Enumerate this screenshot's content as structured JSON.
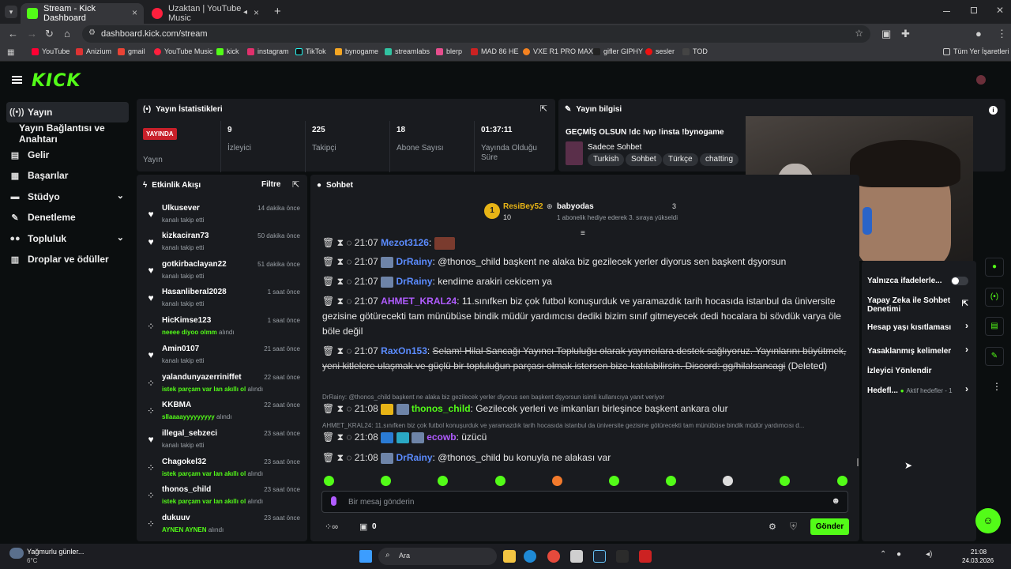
{
  "browser": {
    "tabs": [
      {
        "label": "Stream - Kick Dashboard",
        "close": "×"
      },
      {
        "label": "Uzaktan | YouTube Music",
        "close": "×"
      }
    ],
    "new_tab": "+",
    "url": "dashboard.kick.com/stream",
    "bookmarks": [
      "YouTube",
      "Anizium",
      "gmail",
      "YouTube Music",
      "kick",
      "instagram",
      "TikTok",
      "bynogame",
      "streamlabs",
      "blerp",
      "MAD 86 HE",
      "VXE R1 PRO MAX",
      "gifler GIPHY",
      "sesler",
      "TOD"
    ],
    "all_bookmarks": "Tüm Yer İşaretleri"
  },
  "brand": {
    "logo": "KICK",
    "accent": "#53fc18"
  },
  "sidebar": {
    "items": [
      {
        "label": "Yayın"
      },
      {
        "label": "Yayın Bağlantısı ve Anahtarı"
      },
      {
        "label": "Gelir"
      },
      {
        "label": "Başarılar"
      },
      {
        "label": "Stüdyo"
      },
      {
        "label": "Denetleme"
      },
      {
        "label": "Topluluk"
      },
      {
        "label": "Droplar ve ödüller"
      }
    ]
  },
  "stats": {
    "title": "Yayın İstatistikleri",
    "live_badge": "YAYINDA",
    "live_label": "Yayın",
    "cells": [
      {
        "value": "9",
        "label": "İzleyici"
      },
      {
        "value": "225",
        "label": "Takipçi"
      },
      {
        "value": "18",
        "label": "Abone Sayısı"
      },
      {
        "value": "01:37:11",
        "label": "Yayında Olduğu Süre"
      }
    ]
  },
  "info": {
    "title": "Yayın bilgisi",
    "stream_title": "GEÇMİŞ OLSUN !dc !wp !insta !bynogame",
    "category": "Sadece Sohbet",
    "tags": [
      "Turkish",
      "Sohbet",
      "Türkçe",
      "chatting"
    ]
  },
  "activity": {
    "title": "Etkinlik Akışı",
    "filter": "Filtre",
    "items": [
      {
        "name": "Ulkusever",
        "time": "14 dakika önce",
        "sub": "kanalı takip etti",
        "redeem": ""
      },
      {
        "name": "kizkaciran73",
        "time": "50 dakika önce",
        "sub": "kanalı takip etti",
        "redeem": ""
      },
      {
        "name": "gotkirbaclayan22",
        "time": "51 dakika önce",
        "sub": "kanalı takip etti",
        "redeem": ""
      },
      {
        "name": "Hasanliberal2028",
        "time": "1 saat önce",
        "sub": "kanalı takip etti",
        "redeem": ""
      },
      {
        "name": "HicKimse123",
        "time": "1 saat önce",
        "sub": "alındı",
        "redeem": "neeee diyoo olmm"
      },
      {
        "name": "Amin0107",
        "time": "21 saat önce",
        "sub": "kanalı takip etti",
        "redeem": ""
      },
      {
        "name": "yalandunyazerriniffet",
        "time": "22 saat önce",
        "sub": "alındı",
        "redeem": "istek parçam var lan akıllı ol"
      },
      {
        "name": "KKBMA",
        "time": "22 saat önce",
        "sub": "alındı",
        "redeem": "sllaaaayyyyyyyyy"
      },
      {
        "name": "illegal_sebzeci",
        "time": "23 saat önce",
        "sub": "kanalı takip etti",
        "redeem": ""
      },
      {
        "name": "Chagokel32",
        "time": "23 saat önce",
        "sub": "alındı",
        "redeem": "istek parçam var lan akıllı ol"
      },
      {
        "name": "thonos_child",
        "time": "23 saat önce",
        "sub": "alındı",
        "redeem": "istek parçam var lan akıllı ol"
      },
      {
        "name": "dukuuv",
        "time": "23 saat önce",
        "sub": "alındı",
        "redeem": "AYNEN AYNEN"
      }
    ]
  },
  "chat": {
    "title": "Sohbet",
    "pinned": {
      "rank": "1",
      "user": "ResiBey52",
      "count": "10",
      "gifter": "babyodas",
      "gift_count": "3",
      "note": "1 abonelik hediye ederek 3. sıraya yükseldi"
    },
    "messages": [
      {
        "time": "21:07",
        "user": "Mezot3126",
        "color": "#5b8cff",
        "text": "",
        "deleted": false
      },
      {
        "time": "21:07",
        "user": "DrRainy",
        "color": "#5b8cff",
        "text": "@thonos_child başkent ne alaka biz gezilecek yerler diyorus sen başkent dşyorsun",
        "deleted": false
      },
      {
        "time": "21:07",
        "user": "DrRainy",
        "color": "#5b8cff",
        "text": "kendime arakiri cekicem ya",
        "deleted": false
      },
      {
        "time": "21:07",
        "user": "AHMET_KRAL24",
        "color": "#b05cff",
        "text": "11.sınıfken biz çok futbol konuşurduk ve yaramazdık tarih hocasıda istanbul da üniversite gezisine götürecekti tam münübüse bindik müdür yardımcısı dediki bizim sınıf gitmeyecek dedi hocalara bi sövdük varya öle böle değil",
        "deleted": false
      },
      {
        "time": "21:07",
        "user": "RaxOn153",
        "color": "#5b8cff",
        "text": "Selam! Hilal Sancağı Yayıncı Topluluğu olarak yayıncılara destek sağlıyoruz. Yayınlarını büyütmek, yeni kitlelere ulaşmak ve güçlü bir topluluğun parçası olmak istersen bize katılabilirsin. Discord: gg/hilalsancagi",
        "deleted": true,
        "deleted_label": "(Deleted)"
      },
      {
        "time": "21:08",
        "user": "thonos_child",
        "color": "#53fc18",
        "text": "Gezilecek yerleri ve imkanları birleşince başkent ankara olur",
        "deleted": false,
        "reply": "DrRainy: @thonos_child başkent ne alaka biz gezilecek yerler diyorus sen başkent dşyorsun isimli kullanıcıya yanıt veriyor"
      },
      {
        "time": "21:08",
        "user": "ecowb",
        "color": "#b05cff",
        "text": "üzücü",
        "deleted": false,
        "reply": "AHMET_KRAL24: 11.sınıfken biz çok futbol konuşurduk ve yaramazdık tarih hocasıda istanbul da üniversite gezisine götürecekti tam münübüse bindik müdür yardımcısı d..."
      },
      {
        "time": "21:08",
        "user": "DrRainy",
        "color": "#5b8cff",
        "text": "@thonos_child bu konuyla ne alakası var",
        "deleted": false
      }
    ],
    "placeholder": "Bir mesaj gönderin",
    "points": "0",
    "send": "Gönder"
  },
  "mod_panel": {
    "rows": [
      {
        "label": "Yalnızca ifadelerle..."
      },
      {
        "label": "Yapay Zeka ile Sohbet Denetimi"
      },
      {
        "label": "Hesap yaşı kısıtlaması"
      },
      {
        "label": "Yasaklanmış kelimeler"
      },
      {
        "label": "İzleyici Yönlendir"
      },
      {
        "label": "Hedefl...",
        "extra": "Aktif hedefler - 1"
      }
    ]
  },
  "taskbar": {
    "weather": "Yağmurlu günler...",
    "temp": "6°C",
    "search": "Ara",
    "time": "21:08",
    "date": "24.03.2026"
  }
}
